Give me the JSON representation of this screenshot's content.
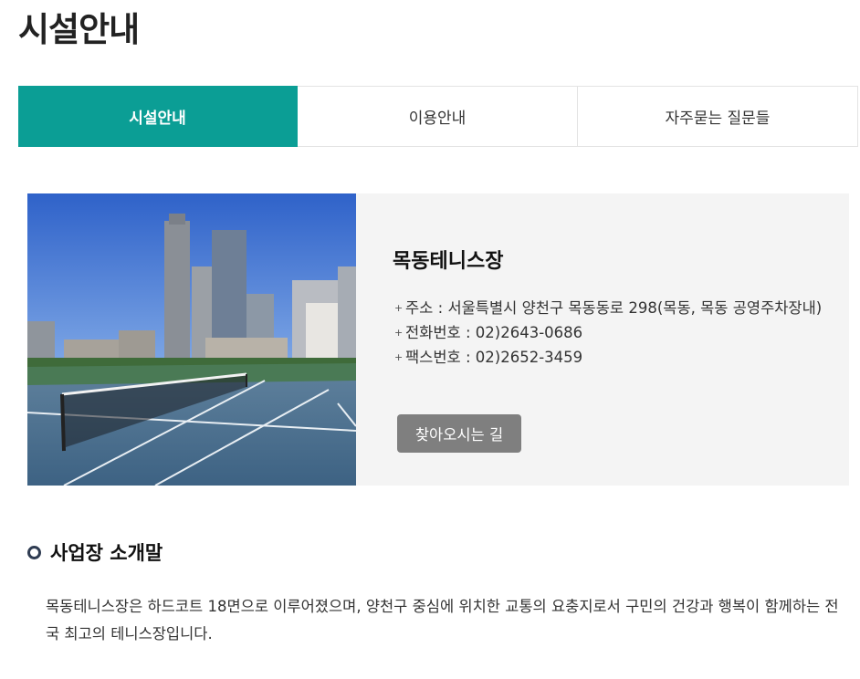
{
  "page": {
    "title": "시설안내"
  },
  "tabs": [
    {
      "label": "시설안내",
      "active": true
    },
    {
      "label": "이용안내",
      "active": false
    },
    {
      "label": "자주묻는 질문들",
      "active": false
    }
  ],
  "facility": {
    "name": "목동테니스장",
    "photo_alt": "테니스장 사진",
    "info": [
      {
        "label": "주소",
        "value": "서울특별시 양천구 목동동로 298(목동, 목동 공영주차장내)"
      },
      {
        "label": "전화번호",
        "value": "02)2643-0686"
      },
      {
        "label": "팩스번호",
        "value": "02)2652-3459"
      }
    ],
    "directions_button": "찾아오시는 길"
  },
  "intro": {
    "heading": "사업장 소개말",
    "text": "목동테니스장은 하드코트 18면으로 이루어졌으며, 양천구 중심에 위치한 교통의 요충지로서 구민의 건강과 행복이 함께하는 전국 최고의 테니스장입니다."
  },
  "colors": {
    "accent": "#0b9e95",
    "button": "#7f7f7f",
    "panel": "#f4f4f4"
  }
}
